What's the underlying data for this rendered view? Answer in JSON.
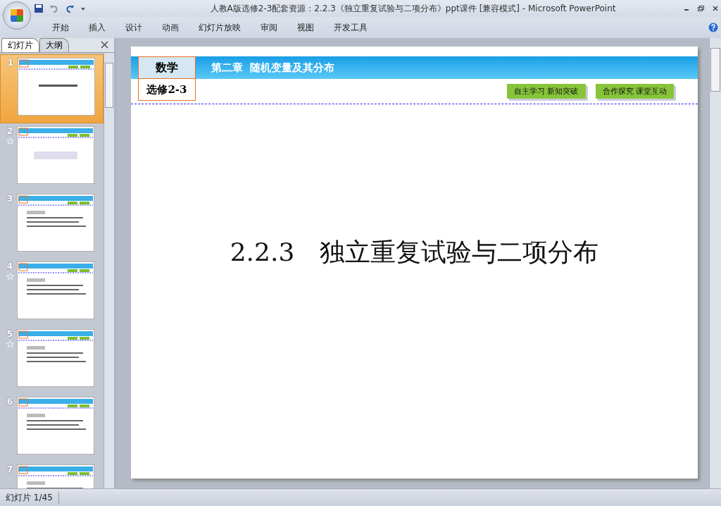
{
  "window": {
    "title": "人教A版选修2-3配套资源：2.2.3《独立重复试验与二项分布》ppt课件 [兼容模式] - Microsoft PowerPoint"
  },
  "ribbon_tabs": [
    {
      "label": "开始",
      "selected": false
    },
    {
      "label": "插入",
      "selected": false
    },
    {
      "label": "设计",
      "selected": false
    },
    {
      "label": "动画",
      "selected": false
    },
    {
      "label": "幻灯片放映",
      "selected": false
    },
    {
      "label": "审阅",
      "selected": false
    },
    {
      "label": "视图",
      "selected": false
    },
    {
      "label": "开发工具",
      "selected": false
    }
  ],
  "pane_tabs": [
    {
      "label": "幻灯片",
      "selected": true
    },
    {
      "label": "大纲",
      "selected": false
    }
  ],
  "thumbnails": [
    {
      "number": "1",
      "selected": true,
      "animated": false
    },
    {
      "number": "2",
      "selected": false,
      "animated": true
    },
    {
      "number": "3",
      "selected": false,
      "animated": false
    },
    {
      "number": "4",
      "selected": false,
      "animated": true
    },
    {
      "number": "5",
      "selected": false,
      "animated": true
    },
    {
      "number": "6",
      "selected": false,
      "animated": false
    },
    {
      "number": "7",
      "selected": false,
      "animated": false
    }
  ],
  "slide": {
    "subject": "数学",
    "course": "选修2-3",
    "chapter": "第二章  随机变量及其分布",
    "nav_buttons": [
      "自主学习 新知突破",
      "合作探究 课堂互动"
    ],
    "title": "2.2.3　独立重复试验与二项分布"
  },
  "status_bar": {
    "text": "幻灯片 1/45"
  }
}
